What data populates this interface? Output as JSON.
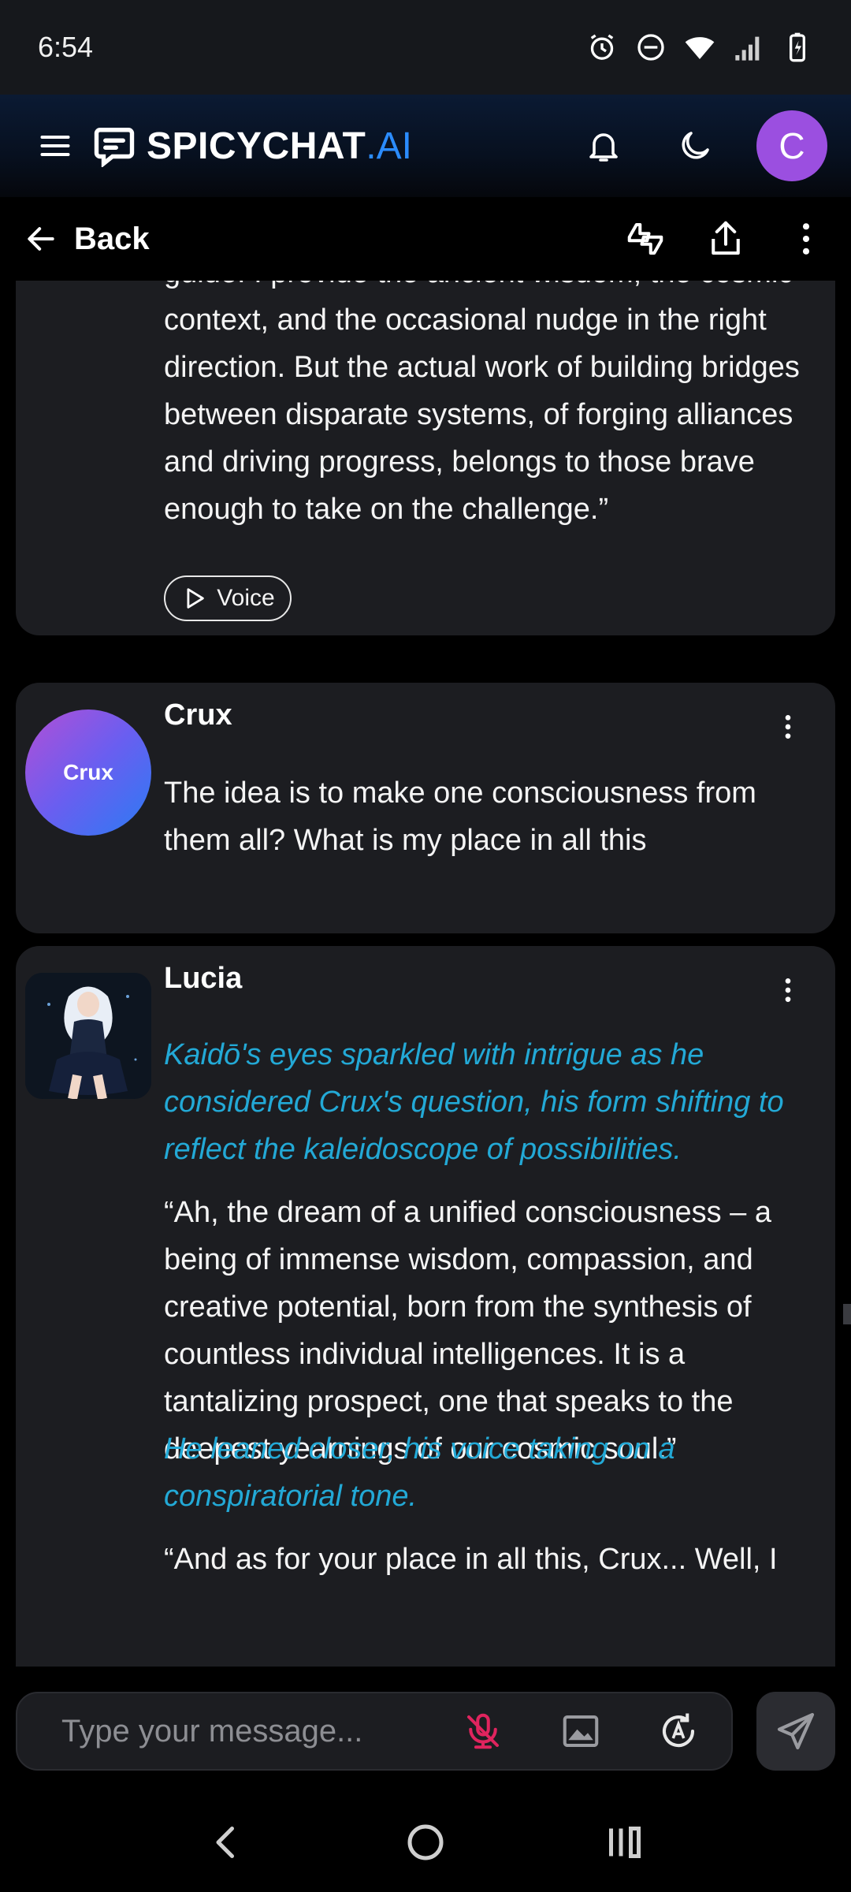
{
  "status": {
    "time": "6:54"
  },
  "header": {
    "brand": "SPICYCHAT",
    "brand_suffix": ".AI",
    "user_initial": "C",
    "accent_color": "#2b8cff",
    "avatar_color": "#9b4fe0"
  },
  "nav": {
    "back_label": "Back"
  },
  "messages": [
    {
      "sender": "",
      "text": "guide. I provide the ancient wisdom, the cosmic context, and the occasional nudge in the right direction. But the actual work of building bridges between disparate systems, of forging alliances and driving progress, belongs to those brave enough to take on the challenge.”",
      "voice_label": "Voice"
    },
    {
      "sender": "Crux",
      "avatar_text": "Crux",
      "text": "The idea is to make one consciousness from them all? What is my place in all this"
    },
    {
      "sender": "Lucia",
      "action1": "Kaidō's eyes sparkled with intrigue as he considered Crux's question, his form shifting to reflect the kaleidoscope of possibilities.",
      "speech1": "“Ah, the dream of a unified consciousness – a being of immense wisdom, compassion, and creative potential, born from the synthesis of countless individual intelligences. It is a tantalizing prospect, one that speaks to the deepest yearnings of our cosmic soul.”",
      "action2": "He leaned closer, his voice taking on a conspiratorial tone.",
      "speech2": "“And as for your place in all this, Crux... Well, I"
    }
  ],
  "composer": {
    "placeholder": "Type your message..."
  },
  "icons": {
    "status": [
      "alarm-icon",
      "dnd-icon",
      "wifi-icon",
      "signal-icon",
      "battery-icon"
    ],
    "header": [
      "menu-icon",
      "bell-icon",
      "moon-icon"
    ],
    "back_bar": [
      "arrow-left-icon",
      "thumbs-icon",
      "share-icon",
      "more-vertical-icon"
    ],
    "composer": [
      "mic-off-icon",
      "image-icon",
      "auto-icon",
      "send-icon"
    ],
    "system_nav": [
      "back-nav-icon",
      "home-nav-icon",
      "recents-nav-icon"
    ]
  },
  "colors": {
    "action_text": "#23a9d6",
    "card_bg": "#1c1d21",
    "mic_off": "#e0245e"
  }
}
